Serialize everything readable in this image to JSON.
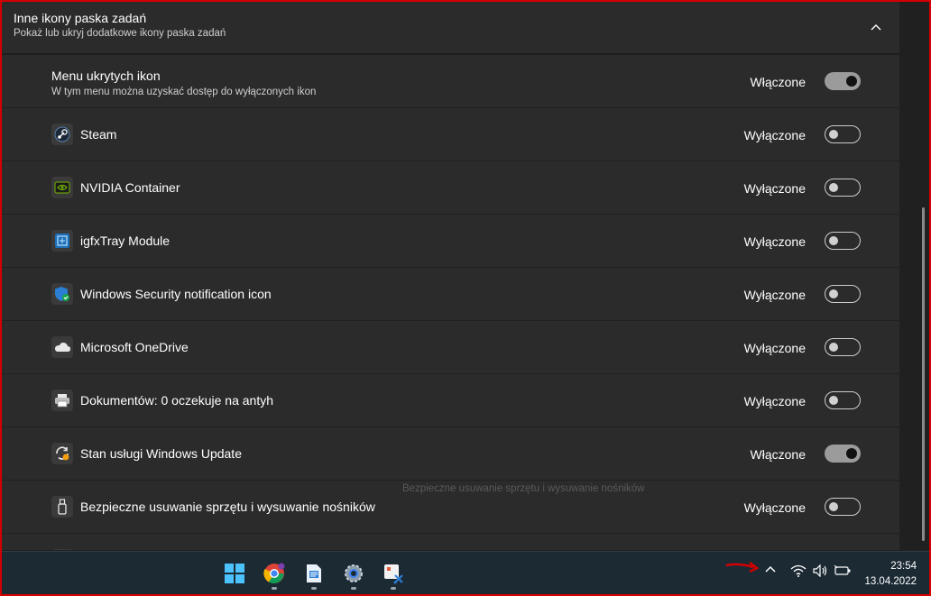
{
  "header": {
    "title": "Inne ikony paska zadań",
    "subtitle": "Pokaż lub ukryj dodatkowe ikony paska zadań"
  },
  "hidden_menu": {
    "label": "Menu ukrytych ikon",
    "description": "W tym menu można uzyskać dostęp do wyłączonych ikon",
    "state": "Włączone",
    "on": true
  },
  "items": [
    {
      "label": "Steam",
      "state": "Wyłączone",
      "on": false,
      "icon": "steam-icon"
    },
    {
      "label": "NVIDIA Container",
      "state": "Wyłączone",
      "on": false,
      "icon": "nvidia-icon"
    },
    {
      "label": "igfxTray Module",
      "state": "Wyłączone",
      "on": false,
      "icon": "intel-graphics-icon"
    },
    {
      "label": "Windows Security notification icon",
      "state": "Wyłączone",
      "on": false,
      "icon": "windows-security-icon"
    },
    {
      "label": "Microsoft OneDrive",
      "state": "Wyłączone",
      "on": false,
      "icon": "onedrive-icon"
    },
    {
      "label": "Dokumentów: 0 oczekuje na antyh",
      "state": "Wyłączone",
      "on": false,
      "icon": "printer-icon"
    },
    {
      "label": "Stan usługi Windows Update",
      "state": "Włączone",
      "on": true,
      "icon": "windows-update-icon"
    },
    {
      "label": "Bezpieczne usuwanie sprzętu i wysuwanie nośników",
      "state": "Wyłączone",
      "on": false,
      "icon": "usb-eject-icon"
    }
  ],
  "tooltip": "Bezpieczne usuwanie sprzętu i wysuwanie nośników",
  "taskbar": {
    "apps": [
      "start-icon",
      "chrome-icon",
      "notepad-icon",
      "settings-gear-icon",
      "snipping-tool-icon"
    ],
    "time": "23:54",
    "date": "13.04.2022"
  },
  "colors": {
    "background": "#202020",
    "card": "#2b2b2b",
    "toggle_on": "#9b9b9b",
    "taskbar": "#1c2a34",
    "annotation": "#d40000"
  }
}
